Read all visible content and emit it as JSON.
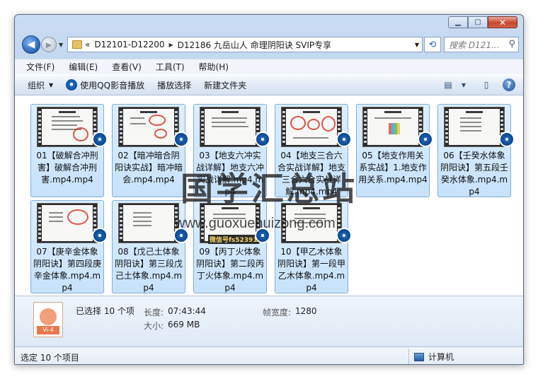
{
  "address": {
    "prefix": "«",
    "parts": [
      "D12101-D12200",
      "D12186 九岳山人 命理阴阳诀 SVIP专享"
    ]
  },
  "search": {
    "placeholder": "搜索 D121..."
  },
  "menu": [
    "文件(F)",
    "编辑(E)",
    "查看(V)",
    "工具(T)",
    "帮助(H)"
  ],
  "toolbar": {
    "organize": "组织",
    "play_qq": "使用QQ影音播放",
    "play_selection": "播放选择",
    "new_folder": "新建文件夹"
  },
  "files": [
    {
      "label": "01【破解合冲刑害】破解合冲刑害.mp4.mp4"
    },
    {
      "label": "02【暗冲暗合阴阳诀实战】暗冲暗会.mp4.mp4"
    },
    {
      "label": "03【地支六冲实战详解】地支六冲实战详解.mp4.mp4"
    },
    {
      "label": "04【地支三合六合实战详解】地支三合六合实战详解.mp4.mp4"
    },
    {
      "label": "05【地支作用关系实战】1.地支作用关系.mp4.mp4"
    },
    {
      "label": "06【壬癸水体象阴阳诀】第五段壬癸水体象.mp4.mp4"
    },
    {
      "label": "07【庚辛金体象阴阳诀】第四段庚辛金体象.mp4.mp4"
    },
    {
      "label": "08【戊己土体象阴阳诀】第三段戊己土体象.mp4.mp4"
    },
    {
      "label": "09【丙丁火体象阴阳诀】第二段丙丁火体象.mp4.mp4",
      "overlay": "微信号fs52391"
    },
    {
      "label": "10【甲乙木体象阴阳诀】第一段甲乙木体象.mp4.mp4"
    }
  ],
  "watermark": {
    "cn": "国学汇总站",
    "url": "www.guoxuehuizong.com"
  },
  "details": {
    "selected": "已选择 10 个项",
    "length_label": "长度:",
    "length_value": "07:43:44",
    "size_label": "大小:",
    "size_value": "669 MB",
    "width_label": "帧宽度:",
    "width_value": "1280",
    "icon_tag": "Vi-4"
  },
  "status": {
    "left": "选定 10 个项目",
    "right": "计算机"
  }
}
